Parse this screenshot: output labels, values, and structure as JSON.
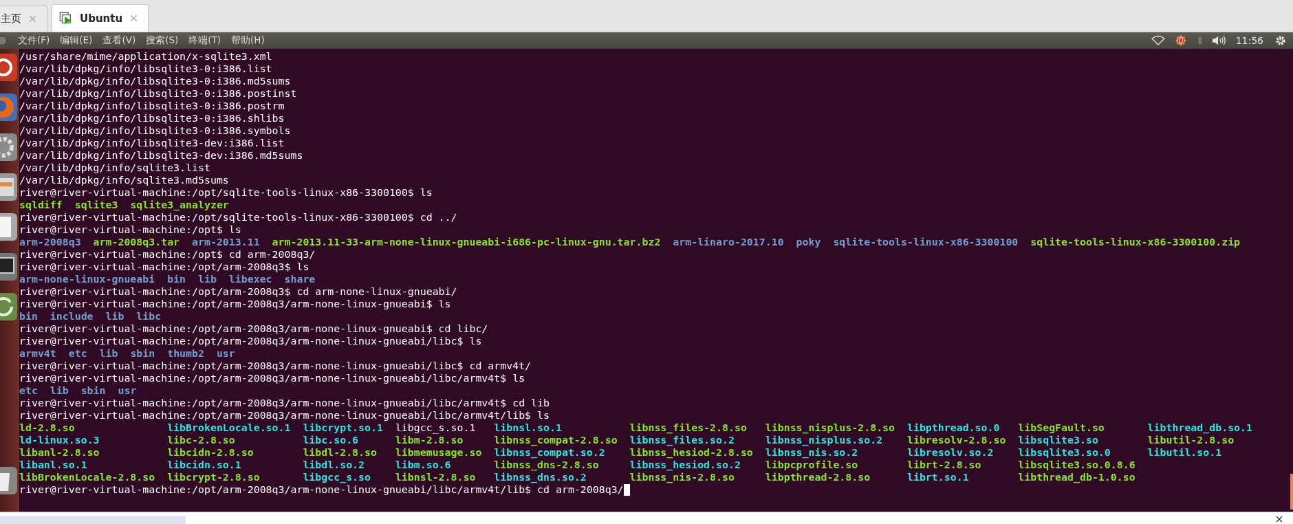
{
  "tabs": [
    {
      "label": "主页",
      "selected": false
    },
    {
      "label": "Ubuntu",
      "selected": true
    }
  ],
  "menu": [
    "文件(F)",
    "编辑(E)",
    "查看(V)",
    "搜索(S)",
    "终端(T)",
    "帮助(H)"
  ],
  "indicators": {
    "clock": "11:56"
  },
  "terminal": {
    "lines": [
      {
        "kind": "text",
        "text": "/usr/share/mime/application/x-sqlite3.xml"
      },
      {
        "kind": "text",
        "text": "/var/lib/dpkg/info/libsqlite3-0:i386.list"
      },
      {
        "kind": "text",
        "text": "/var/lib/dpkg/info/libsqlite3-0:i386.md5sums"
      },
      {
        "kind": "text",
        "text": "/var/lib/dpkg/info/libsqlite3-0:i386.postinst"
      },
      {
        "kind": "text",
        "text": "/var/lib/dpkg/info/libsqlite3-0:i386.postrm"
      },
      {
        "kind": "text",
        "text": "/var/lib/dpkg/info/libsqlite3-0:i386.shlibs"
      },
      {
        "kind": "text",
        "text": "/var/lib/dpkg/info/libsqlite3-0:i386.symbols"
      },
      {
        "kind": "text",
        "text": "/var/lib/dpkg/info/libsqlite3-dev:i386.list"
      },
      {
        "kind": "text",
        "text": "/var/lib/dpkg/info/libsqlite3-dev:i386.md5sums"
      },
      {
        "kind": "text",
        "text": "/var/lib/dpkg/info/sqlite3.list"
      },
      {
        "kind": "text",
        "text": "/var/lib/dpkg/info/sqlite3.md5sums"
      },
      {
        "kind": "text",
        "text": "river@river-virtual-machine:/opt/sqlite-tools-linux-x86-3300100$ ls"
      },
      {
        "kind": "listing",
        "items": [
          {
            "text": "sqldiff",
            "color": "#8ae234"
          },
          {
            "text": "sqlite3",
            "color": "#8ae234"
          },
          {
            "text": "sqlite3_analyzer",
            "color": "#8ae234"
          }
        ]
      },
      {
        "kind": "text",
        "text": "river@river-virtual-machine:/opt/sqlite-tools-linux-x86-3300100$ cd ../"
      },
      {
        "kind": "text",
        "text": "river@river-virtual-machine:/opt$ ls"
      },
      {
        "kind": "listing",
        "items": [
          {
            "text": "arm-2008q3",
            "color": "#729fcf"
          },
          {
            "text": "arm-2008q3.tar",
            "color": "#8ae234"
          },
          {
            "text": "arm-2013.11",
            "color": "#729fcf"
          },
          {
            "text": "arm-2013.11-33-arm-none-linux-gnueabi-i686-pc-linux-gnu.tar.bz2",
            "color": "#8ae234"
          },
          {
            "text": "arm-linaro-2017.10",
            "color": "#729fcf"
          },
          {
            "text": "poky",
            "color": "#729fcf"
          },
          {
            "text": "sqlite-tools-linux-x86-3300100",
            "color": "#729fcf"
          },
          {
            "text": "sqlite-tools-linux-x86-3300100.zip",
            "color": "#8ae234"
          }
        ]
      },
      {
        "kind": "text",
        "text": "river@river-virtual-machine:/opt$ cd arm-2008q3/"
      },
      {
        "kind": "text",
        "text": "river@river-virtual-machine:/opt/arm-2008q3$ ls"
      },
      {
        "kind": "listing",
        "items": [
          {
            "text": "arm-none-linux-gnueabi",
            "color": "#729fcf"
          },
          {
            "text": "bin",
            "color": "#729fcf"
          },
          {
            "text": "lib",
            "color": "#729fcf"
          },
          {
            "text": "libexec",
            "color": "#729fcf"
          },
          {
            "text": "share",
            "color": "#729fcf"
          }
        ]
      },
      {
        "kind": "text",
        "text": "river@river-virtual-machine:/opt/arm-2008q3$ cd arm-none-linux-gnueabi/"
      },
      {
        "kind": "text",
        "text": "river@river-virtual-machine:/opt/arm-2008q3/arm-none-linux-gnueabi$ ls"
      },
      {
        "kind": "listing",
        "items": [
          {
            "text": "bin",
            "color": "#729fcf"
          },
          {
            "text": "include",
            "color": "#729fcf"
          },
          {
            "text": "lib",
            "color": "#729fcf"
          },
          {
            "text": "libc",
            "color": "#729fcf"
          }
        ]
      },
      {
        "kind": "text",
        "text": "river@river-virtual-machine:/opt/arm-2008q3/arm-none-linux-gnueabi$ cd libc/"
      },
      {
        "kind": "text",
        "text": "river@river-virtual-machine:/opt/arm-2008q3/arm-none-linux-gnueabi/libc$ ls"
      },
      {
        "kind": "listing",
        "items": [
          {
            "text": "armv4t",
            "color": "#729fcf"
          },
          {
            "text": "etc",
            "color": "#729fcf"
          },
          {
            "text": "lib",
            "color": "#729fcf"
          },
          {
            "text": "sbin",
            "color": "#729fcf"
          },
          {
            "text": "thumb2",
            "color": "#729fcf"
          },
          {
            "text": "usr",
            "color": "#729fcf"
          }
        ]
      },
      {
        "kind": "text",
        "text": "river@river-virtual-machine:/opt/arm-2008q3/arm-none-linux-gnueabi/libc$ cd armv4t/"
      },
      {
        "kind": "text",
        "text": "river@river-virtual-machine:/opt/arm-2008q3/arm-none-linux-gnueabi/libc/armv4t$ ls"
      },
      {
        "kind": "listing",
        "items": [
          {
            "text": "etc",
            "color": "#729fcf"
          },
          {
            "text": "lib",
            "color": "#729fcf"
          },
          {
            "text": "sbin",
            "color": "#729fcf"
          },
          {
            "text": "usr",
            "color": "#729fcf"
          }
        ]
      },
      {
        "kind": "text",
        "text": "river@river-virtual-machine:/opt/arm-2008q3/arm-none-linux-gnueabi/libc/armv4t$ cd lib"
      },
      {
        "kind": "text",
        "text": "river@river-virtual-machine:/opt/arm-2008q3/arm-none-linux-gnueabi/libc/armv4t/lib$ ls"
      },
      {
        "kind": "grid",
        "rows": [
          [
            {
              "text": "ld-2.8.so",
              "color": "#8ae234"
            },
            {
              "text": "libBrokenLocale.so.1",
              "color": "#34e2e2"
            },
            {
              "text": "libcrypt.so.1",
              "color": "#34e2e2"
            },
            {
              "text": "libgcc_s.so.1",
              "color": "#ffffff"
            },
            {
              "text": "libnsl.so.1",
              "color": "#34e2e2"
            },
            {
              "text": "libnss_files-2.8.so",
              "color": "#8ae234"
            },
            {
              "text": "libnss_nisplus-2.8.so",
              "color": "#8ae234"
            },
            {
              "text": "libpthread.so.0",
              "color": "#34e2e2"
            },
            {
              "text": "libSegFault.so",
              "color": "#8ae234"
            },
            {
              "text": "libthread_db.so.1",
              "color": "#34e2e2"
            }
          ],
          [
            {
              "text": "ld-linux.so.3",
              "color": "#34e2e2"
            },
            {
              "text": "libc-2.8.so",
              "color": "#8ae234"
            },
            {
              "text": "libc.so.6",
              "color": "#34e2e2"
            },
            {
              "text": "libm-2.8.so",
              "color": "#8ae234"
            },
            {
              "text": "libnss_compat-2.8.so",
              "color": "#8ae234"
            },
            {
              "text": "libnss_files.so.2",
              "color": "#34e2e2"
            },
            {
              "text": "libnss_nisplus.so.2",
              "color": "#34e2e2"
            },
            {
              "text": "libresolv-2.8.so",
              "color": "#8ae234"
            },
            {
              "text": "libsqlite3.so",
              "color": "#34e2e2"
            },
            {
              "text": "libutil-2.8.so",
              "color": "#8ae234"
            }
          ],
          [
            {
              "text": "libanl-2.8.so",
              "color": "#8ae234"
            },
            {
              "text": "libcidn-2.8.so",
              "color": "#8ae234"
            },
            {
              "text": "libdl-2.8.so",
              "color": "#8ae234"
            },
            {
              "text": "libmemusage.so",
              "color": "#8ae234"
            },
            {
              "text": "libnss_compat.so.2",
              "color": "#34e2e2"
            },
            {
              "text": "libnss_hesiod-2.8.so",
              "color": "#8ae234"
            },
            {
              "text": "libnss_nis.so.2",
              "color": "#34e2e2"
            },
            {
              "text": "libresolv.so.2",
              "color": "#34e2e2"
            },
            {
              "text": "libsqlite3.so.0",
              "color": "#34e2e2"
            },
            {
              "text": "libutil.so.1",
              "color": "#34e2e2"
            }
          ],
          [
            {
              "text": "libanl.so.1",
              "color": "#34e2e2"
            },
            {
              "text": "libcidn.so.1",
              "color": "#34e2e2"
            },
            {
              "text": "libdl.so.2",
              "color": "#34e2e2"
            },
            {
              "text": "libm.so.6",
              "color": "#34e2e2"
            },
            {
              "text": "libnss_dns-2.8.so",
              "color": "#8ae234"
            },
            {
              "text": "libnss_hesiod.so.2",
              "color": "#34e2e2"
            },
            {
              "text": "libpcprofile.so",
              "color": "#8ae234"
            },
            {
              "text": "librt-2.8.so",
              "color": "#8ae234"
            },
            {
              "text": "libsqlite3.so.0.8.6",
              "color": "#8ae234"
            }
          ],
          [
            {
              "text": "libBrokenLocale-2.8.so",
              "color": "#8ae234"
            },
            {
              "text": "libcrypt-2.8.so",
              "color": "#8ae234"
            },
            {
              "text": "libgcc_s.so",
              "color": "#34e2e2"
            },
            {
              "text": "libnsl-2.8.so",
              "color": "#8ae234"
            },
            {
              "text": "libnss_dns.so.2",
              "color": "#34e2e2"
            },
            {
              "text": "libnss_nis-2.8.so",
              "color": "#8ae234"
            },
            {
              "text": "libpthread-2.8.so",
              "color": "#8ae234"
            },
            {
              "text": "librt.so.1",
              "color": "#34e2e2"
            },
            {
              "text": "libthread_db-1.0.so",
              "color": "#8ae234"
            }
          ]
        ]
      },
      {
        "kind": "text",
        "text": "river@river-virtual-machine:/opt/arm-2008q3/arm-none-linux-gnueabi/libc/armv4t/lib$ cd arm-2008q3/",
        "cursor": true
      }
    ]
  }
}
